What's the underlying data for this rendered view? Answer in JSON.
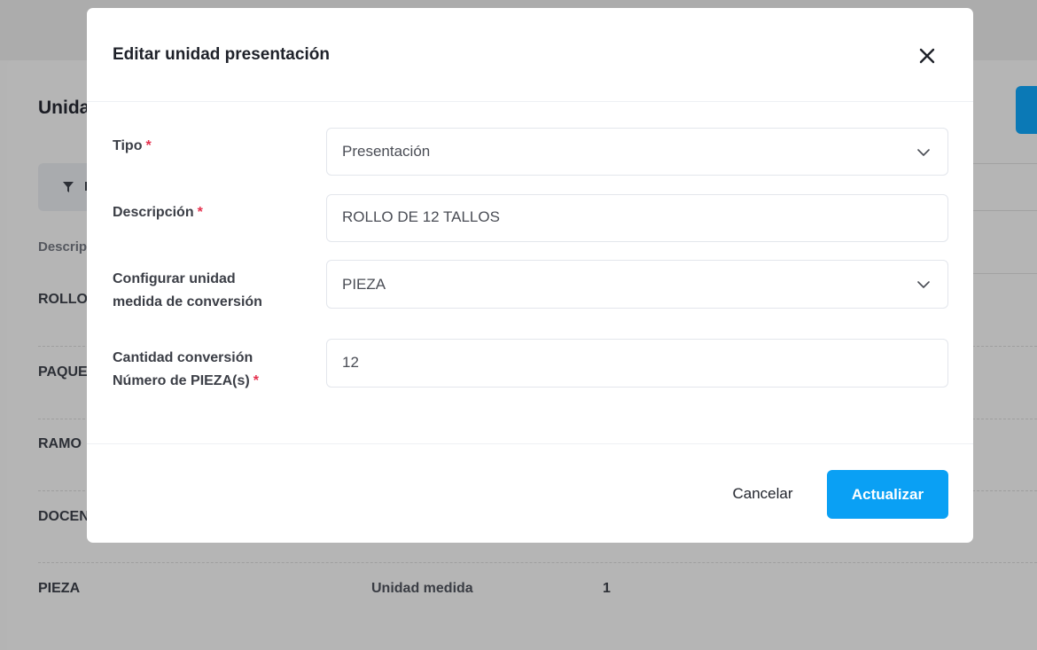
{
  "background": {
    "title": "Unida",
    "filter_label": "F",
    "table_header": "Descrip",
    "rows": [
      {
        "desc": "ROLLO"
      },
      {
        "desc": "PAQUE"
      },
      {
        "desc": "RAMO"
      },
      {
        "desc": "DOCEN"
      },
      {
        "desc": "PIEZA",
        "tipo": "Unidad medida",
        "cantidad": "1"
      }
    ]
  },
  "modal": {
    "title": "Editar unidad presentación",
    "fields": {
      "tipo": {
        "label": "Tipo",
        "required": "*",
        "value": "Presentación"
      },
      "descripcion": {
        "label": "Descripción",
        "required": "*",
        "value": "ROLLO DE 12 TALLOS"
      },
      "configurar": {
        "label_line1": "Configurar unidad",
        "label_line2": "medida de conversión",
        "value": "PIEZA"
      },
      "cantidad": {
        "label_line1": "Cantidad conversión",
        "label_line2": "Número de PIEZA(s)",
        "required": "*",
        "value": "12"
      }
    },
    "footer": {
      "cancel_label": "Cancelar",
      "update_label": "Actualizar"
    }
  },
  "colors": {
    "primary": "#0aa0f4",
    "required": "#e5314e",
    "overlay": "#b4b4b4"
  },
  "icons": {
    "close": "close-icon",
    "chevron": "chevron-down-icon",
    "filter": "filter-icon"
  }
}
